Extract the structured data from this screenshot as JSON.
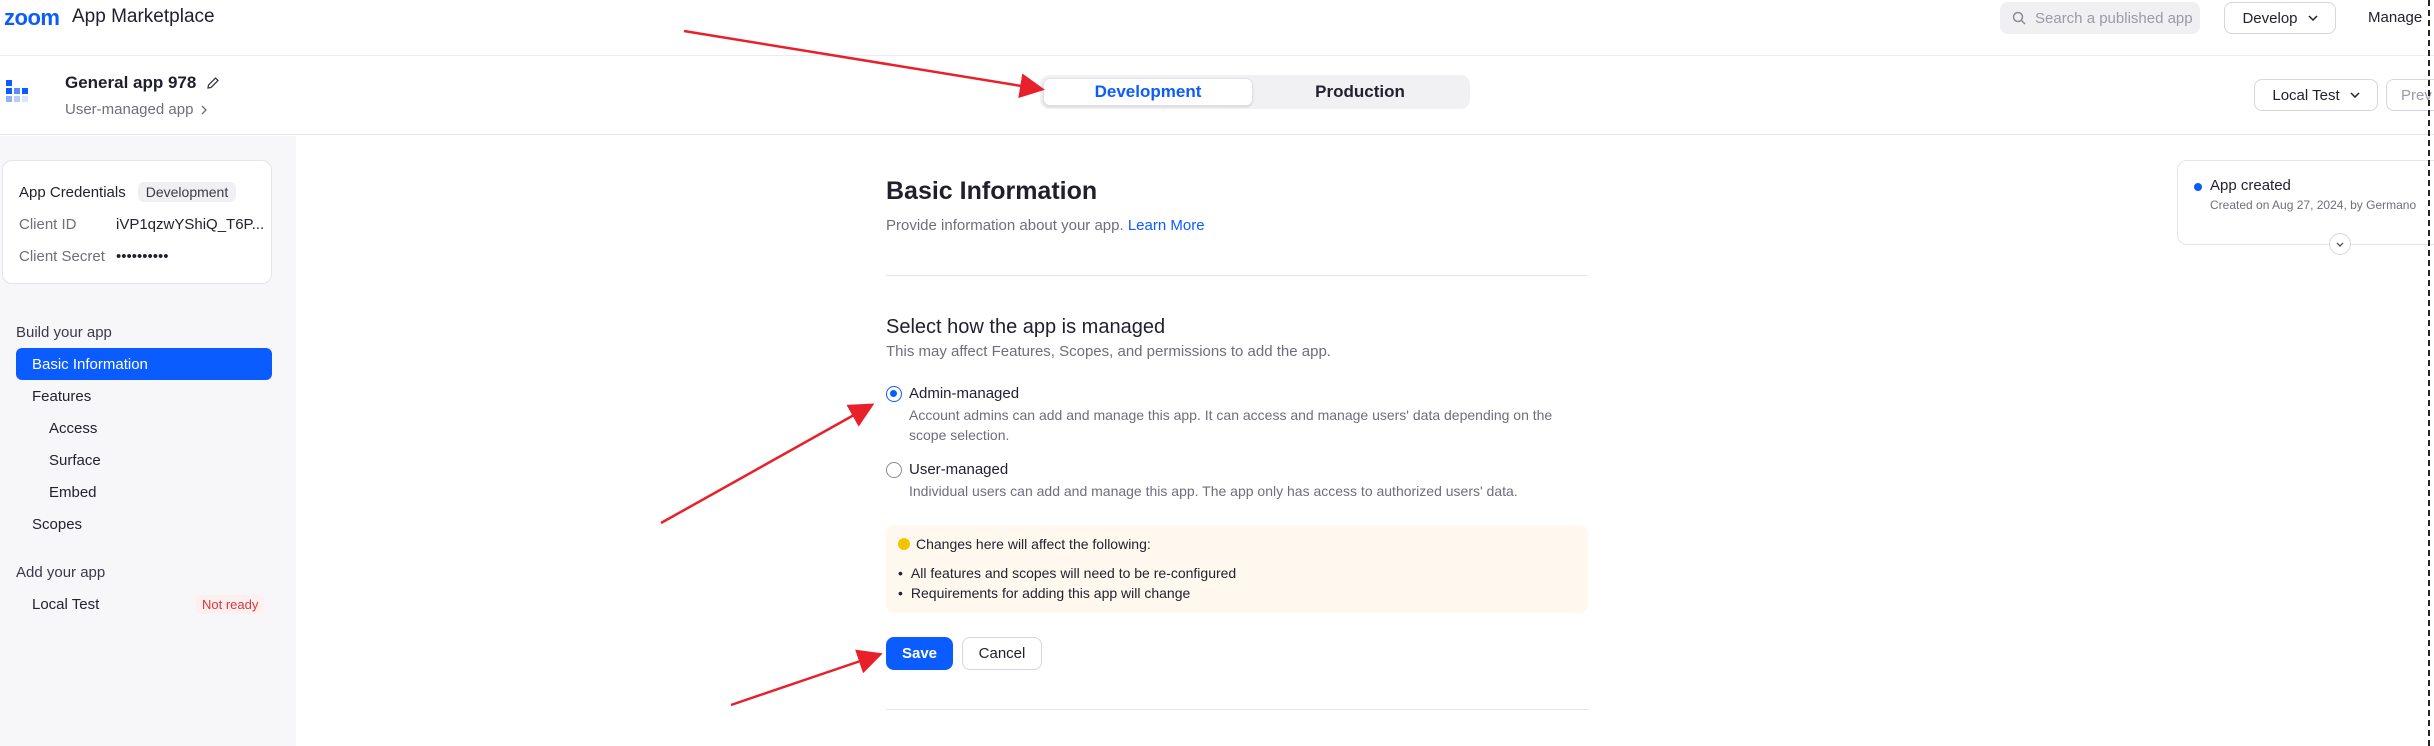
{
  "topnav": {
    "logo": "zoom",
    "title": "App Marketplace",
    "search_placeholder": "Search a published app",
    "develop_label": "Develop",
    "manage_label": "Manage"
  },
  "app_header": {
    "app_name": "General app 978",
    "app_type": "User-managed app",
    "env_tabs": [
      "Development",
      "Production"
    ],
    "active_env": "Development",
    "local_test_label": "Local Test",
    "preview_label": "Prev"
  },
  "sidebar": {
    "credentials": {
      "title": "App Credentials",
      "badge": "Development",
      "client_id_label": "Client ID",
      "client_id_value": "iVP1qzwYShiQ_T6P...",
      "client_secret_label": "Client Secret",
      "client_secret_value": "••••••••••"
    },
    "build_section": "Build your app",
    "items": [
      "Basic Information",
      "Features",
      "Access",
      "Surface",
      "Embed",
      "Scopes"
    ],
    "add_section": "Add your app",
    "local_test_item": "Local Test",
    "local_test_status": "Not ready"
  },
  "main": {
    "title": "Basic Information",
    "description": "Provide information about your app.",
    "learn_more": "Learn More",
    "manage_title": "Select how the app is managed",
    "manage_desc": "This may affect Features, Scopes, and permissions to add the app.",
    "options": [
      {
        "label": "Admin-managed",
        "desc": "Account admins can add and manage this app. It can access and manage users' data depending on the scope selection.",
        "checked": true
      },
      {
        "label": "User-managed",
        "desc": "Individual users can add and manage this app. The app only has access to authorized users' data.",
        "checked": false
      }
    ],
    "warning_title": "Changes here will affect the following:",
    "warning_items": [
      "All features and scopes will need to be re-configured",
      "Requirements for adding this app will change"
    ],
    "save_label": "Save",
    "cancel_label": "Cancel"
  },
  "activity": {
    "title": "App created",
    "subtitle": "Created on Aug 27, 2024, by Germano"
  },
  "colors": {
    "accent": "#0b5cff",
    "annotation": "#e8202a",
    "warning_bg": "#fff8ee"
  }
}
